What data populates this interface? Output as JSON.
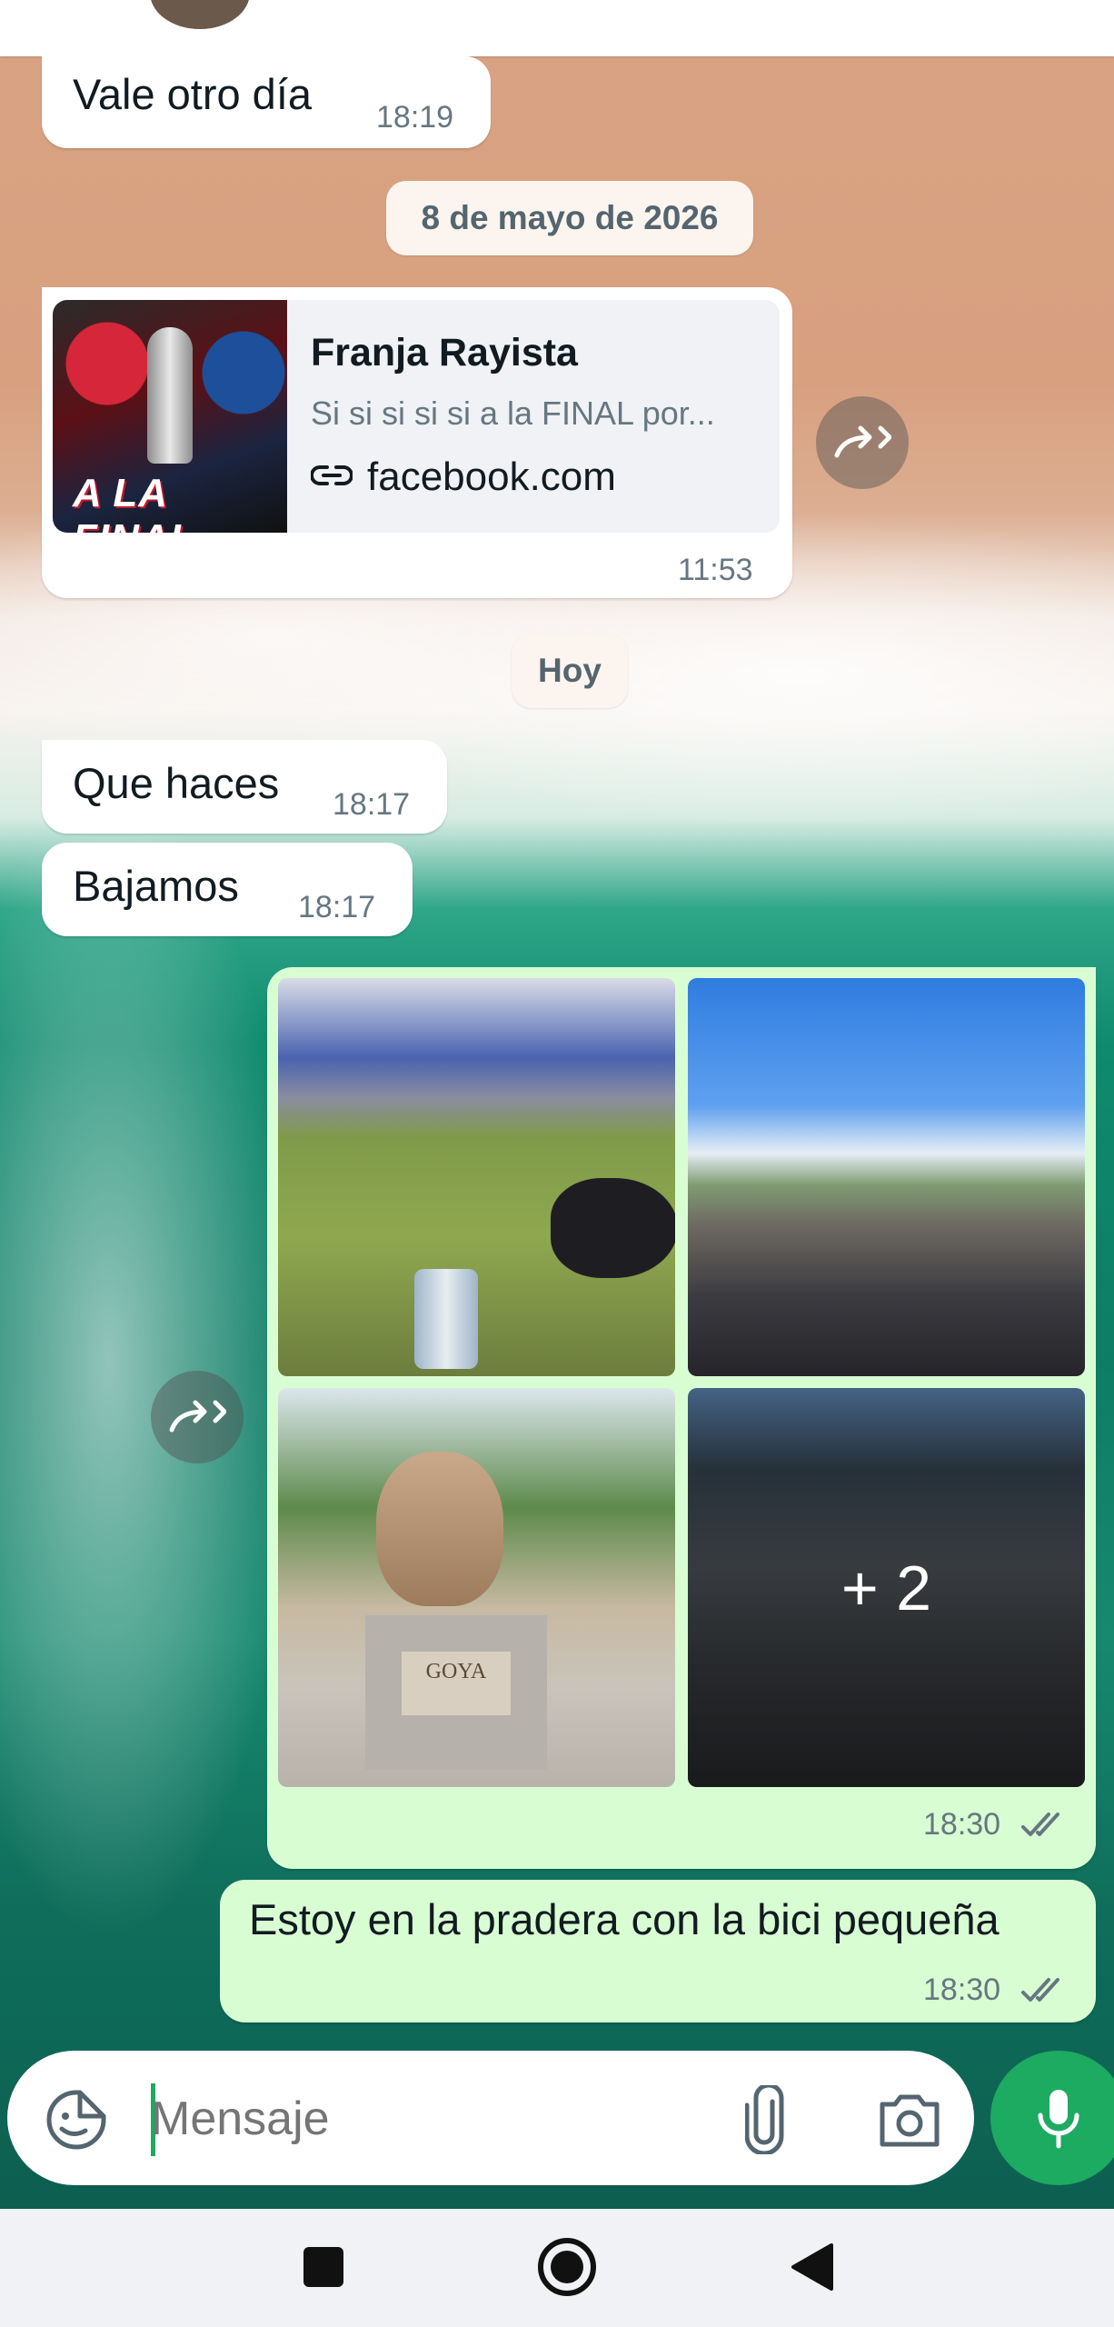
{
  "chat": {
    "messages": [
      {
        "text": "Vale otro día",
        "time": "18:19"
      },
      {
        "link": {
          "title": "Franja Rayista",
          "description": "Si si si si si a la FINAL por...",
          "domain": "facebook.com",
          "thumbnail_text": "A LA FINAL"
        },
        "time": "11:53"
      },
      {
        "text": "Que haces",
        "time": "18:17"
      },
      {
        "text": "Bajamos",
        "time": "18:17"
      },
      {
        "album": {
          "more_count": "+ 2",
          "photo_caption": "GOYA"
        },
        "time": "18:30"
      },
      {
        "text": "Estoy en la pradera con la bici pequeña",
        "time": "18:30"
      }
    ],
    "date_separators": [
      "8 de mayo de 2026",
      "Hoy"
    ]
  },
  "input": {
    "placeholder": "Mensaje"
  },
  "colors": {
    "outgoing_bubble": "#d9fdd3",
    "incoming_bubble": "#ffffff",
    "accent": "#1daa61",
    "date_pill": "#fcf4ee"
  },
  "icons": {
    "sticker": "sticker-icon",
    "attach": "paperclip-icon",
    "camera": "camera-icon",
    "mic": "mic-icon",
    "forward": "forward-icon",
    "link": "link-icon",
    "read": "double-check-icon",
    "nav": [
      "recents-square-icon",
      "home-circle-icon",
      "back-triangle-icon"
    ]
  }
}
